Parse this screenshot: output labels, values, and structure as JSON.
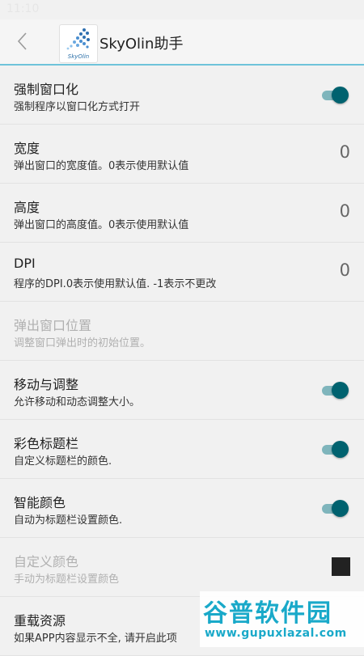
{
  "status_bar": {
    "time": "11:10"
  },
  "app_bar": {
    "title": "SkyOlin助手",
    "logo_text": "SkyOlin",
    "accent_color": "#6ec3da"
  },
  "settings": [
    {
      "title": "强制窗口化",
      "summary": "强制程序以窗口化方式打开",
      "control": "toggle",
      "checked": true,
      "enabled": true
    },
    {
      "title": "宽度",
      "summary": "弹出窗口的宽度值。0表示使用默认值",
      "control": "value",
      "value": "0",
      "enabled": true
    },
    {
      "title": "高度",
      "summary": "弹出窗口的高度值。0表示使用默认值",
      "control": "value",
      "value": "0",
      "enabled": true
    },
    {
      "title": "DPI",
      "summary": "程序的DPI.0表示使用默认值. -1表示不更改",
      "control": "value",
      "value": "0",
      "enabled": true
    },
    {
      "title": "弹出窗口位置",
      "summary": "调整窗口弹出时的初始位置。",
      "control": "none",
      "enabled": false
    },
    {
      "title": "移动与调整",
      "summary": "允许移动和动态调整大小。",
      "control": "toggle",
      "checked": true,
      "enabled": true
    },
    {
      "title": "彩色标题栏",
      "summary": "自定义标题栏的颜色.",
      "control": "toggle",
      "checked": true,
      "enabled": true
    },
    {
      "title": "智能颜色",
      "summary": "自动为标题栏设置颜色.",
      "control": "toggle",
      "checked": true,
      "enabled": true
    },
    {
      "title": "自定义颜色",
      "summary": "手动为标题栏设置颜色",
      "control": "swatch",
      "color": "#222222",
      "enabled": false
    },
    {
      "title": "重载资源",
      "summary": "如果APP内容显示不全, 请开启此项",
      "control": "none",
      "enabled": true
    }
  ],
  "colors": {
    "toggle_thumb": "#00626f",
    "toggle_track": "#7fb5bc"
  },
  "watermark": {
    "top_text": "谷普软件园",
    "bottom_text": "www.gupuxlazal.com"
  }
}
